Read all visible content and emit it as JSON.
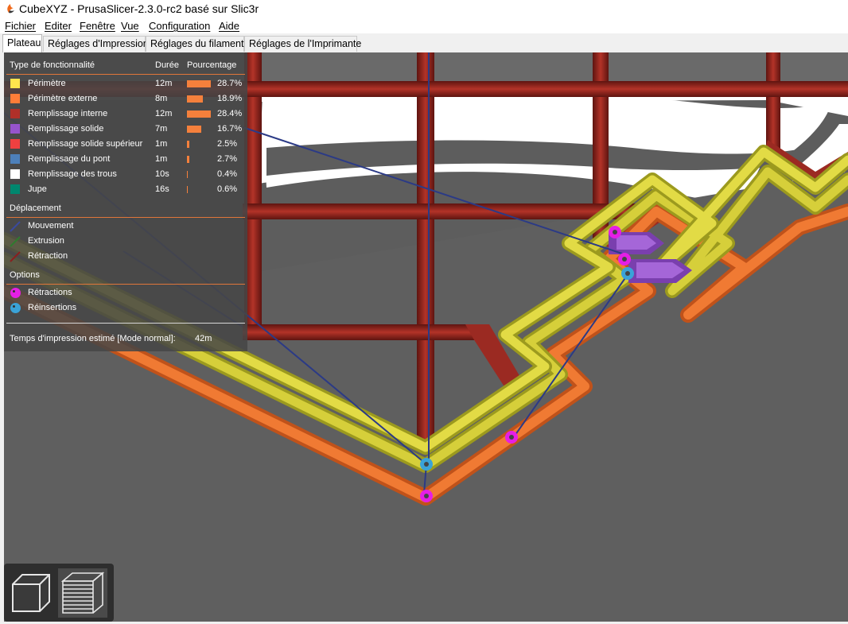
{
  "window": {
    "title": "CubeXYZ - PrusaSlicer-2.3.0-rc2 basé sur Slic3r"
  },
  "menu": [
    {
      "label": "Fichier"
    },
    {
      "label": "Editer"
    },
    {
      "label": "Fenêtre"
    },
    {
      "label": "Vue"
    },
    {
      "label": "Configuration"
    },
    {
      "label": "Aide"
    }
  ],
  "tabs": [
    {
      "label": "Plateau",
      "active": true
    },
    {
      "label": "Réglages d'Impression",
      "active": false
    },
    {
      "label": "Réglages du filament",
      "active": false
    },
    {
      "label": "Réglages de l'Imprimante",
      "active": false
    }
  ],
  "legend": {
    "header": {
      "feature": "Type de fonctionnalité",
      "time": "Durée",
      "percent": "Pourcentage"
    },
    "features": [
      {
        "name": "Périmètre",
        "time": "12m",
        "percent": "28.7%",
        "value": 28.7,
        "color": "#ffe64d"
      },
      {
        "name": "Périmètre externe",
        "time": "8m",
        "percent": "18.9%",
        "value": 18.9,
        "color": "#ff7d38"
      },
      {
        "name": "Remplissage interne",
        "time": "12m",
        "percent": "28.4%",
        "value": 28.4,
        "color": "#b03029"
      },
      {
        "name": "Remplissage solide",
        "time": "7m",
        "percent": "16.7%",
        "value": 16.7,
        "color": "#9654cc"
      },
      {
        "name": "Remplissage solide supérieur",
        "time": "1m",
        "percent": "2.5%",
        "value": 2.5,
        "color": "#f04040"
      },
      {
        "name": "Remplissage du pont",
        "time": "1m",
        "percent": "2.7%",
        "value": 2.7,
        "color": "#4d80ba"
      },
      {
        "name": "Remplissage des trous",
        "time": "10s",
        "percent": "0.4%",
        "value": 0.4,
        "color": "#ffffff"
      },
      {
        "name": "Jupe",
        "time": "16s",
        "percent": "0.6%",
        "value": 0.6,
        "color": "#00876e"
      }
    ],
    "travel_title": "Déplacement",
    "travel": [
      {
        "name": "Mouvement",
        "color": "#3a4a9e"
      },
      {
        "name": "Extrusion",
        "color": "#2f7a2f"
      },
      {
        "name": "Rétraction",
        "color": "#8a1f1f"
      }
    ],
    "options_title": "Options",
    "options": [
      {
        "name": "Rétractions",
        "color": "#e51fe5"
      },
      {
        "name": "Réinsertions",
        "color": "#3aa3d8"
      }
    ],
    "estimate_label": "Temps d'impression estimé [Mode normal]:",
    "estimate_value": "42m"
  },
  "view_toolbar": [
    {
      "icon": "3d-view-icon"
    },
    {
      "icon": "layers-view-icon"
    }
  ]
}
